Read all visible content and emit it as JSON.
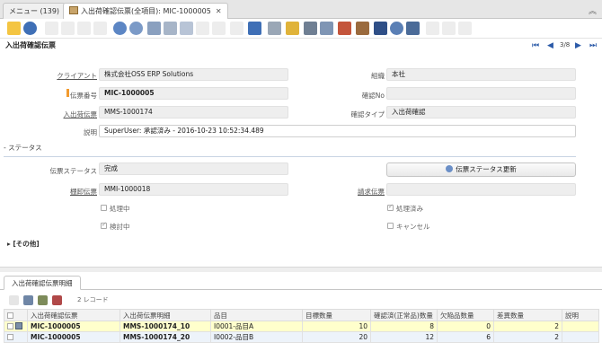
{
  "tabs": {
    "menu": "メニュー (139)",
    "active": "入出荷確認伝票(全項目): MIC-1000005",
    "close": "✕"
  },
  "window_title": "入出荷確認伝票",
  "record_nav": {
    "count": "3/8"
  },
  "fields": {
    "client": {
      "label": "クライアント",
      "value": "株式会社OSS ERP Solutions"
    },
    "org": {
      "label": "組織",
      "value": "本社"
    },
    "doc_no": {
      "label": "伝票番号",
      "value": "MIC-1000005"
    },
    "confirm_no": {
      "label": "確認No",
      "value": ""
    },
    "inout": {
      "label": "入出荷伝票",
      "value": "MMS-1000174"
    },
    "confirm_type": {
      "label": "確認タイプ",
      "value": "入出荷確認"
    },
    "description": {
      "label": "説明",
      "value": "SuperUser: 承認済み - 2016-10-23 10:52:34.489"
    }
  },
  "status_section": {
    "toggle": "- ステータス",
    "doc_status": {
      "label": "伝票ステータス",
      "value": "完成"
    },
    "update_button": "伝票ステータス更新",
    "inventory": {
      "label": "棚卸伝票",
      "value": "MMI-1000018"
    },
    "invoice": {
      "label": "請求伝票",
      "value": ""
    },
    "processing": "処理中",
    "processed": "処理済み",
    "approved": "検討中",
    "cancelled": "キャンセル"
  },
  "other_toggle": "▸ [その他]",
  "detail": {
    "tab": "入出荷確認伝票明細",
    "rows_count": "2 レコード",
    "columns": [
      "",
      "入出荷確認伝票",
      "入出荷伝票明細",
      "品目",
      "目標数量",
      "確認済(正常品)数量",
      "欠陥品数量",
      "差異数量",
      "説明"
    ],
    "rows": [
      {
        "doc": "MIC-1000005",
        "line": "MMS-1000174_10",
        "product": "I0001-品目A",
        "target": "10",
        "confirmed": "8",
        "scrapped": "0",
        "diff": "2",
        "desc": ""
      },
      {
        "doc": "MIC-1000005",
        "line": "MMS-1000174_20",
        "product": "I0002-品目B",
        "target": "20",
        "confirmed": "12",
        "scrapped": "6",
        "diff": "2",
        "desc": ""
      }
    ]
  },
  "colors": {
    "accent": "#2b5aa8",
    "mandatory": "#f29a2e",
    "selected_row": "#ffffcc"
  }
}
